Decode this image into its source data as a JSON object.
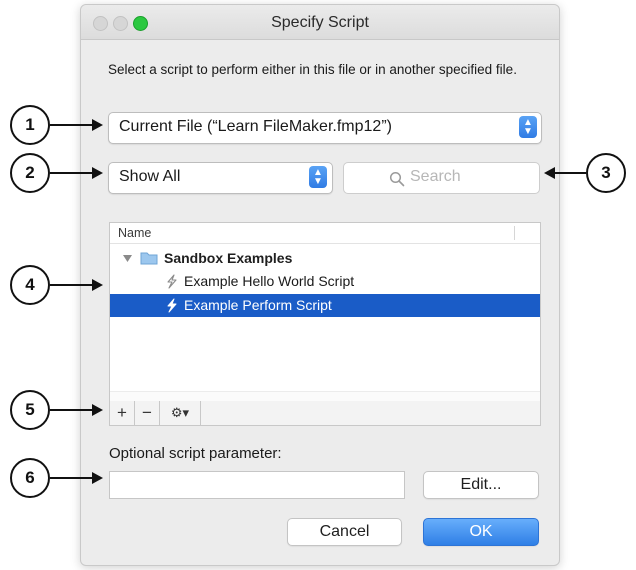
{
  "window": {
    "title": "Specify Script"
  },
  "instructions": "Select a script to perform either in this file or in another specified file.",
  "file_select": {
    "value": "Current File (“Learn FileMaker.fmp12”)"
  },
  "filter_select": {
    "value": "Show All"
  },
  "search": {
    "placeholder": "Search"
  },
  "script_list": {
    "column_header": "Name",
    "folder": {
      "label": "Sandbox Examples",
      "expanded": true
    },
    "items": [
      {
        "label": "Example Hello World Script",
        "selected": false
      },
      {
        "label": "Example Perform Script",
        "selected": true
      }
    ]
  },
  "toolbar": {
    "add_label": "+",
    "remove_label": "−",
    "gear_label": "⚙▾"
  },
  "parameter": {
    "label": "Optional script parameter:",
    "value": "",
    "edit_label": "Edit..."
  },
  "actions": {
    "cancel_label": "Cancel",
    "ok_label": "OK"
  },
  "callouts": [
    "1",
    "2",
    "3",
    "4",
    "5",
    "6"
  ],
  "colors": {
    "accent": "#2f7be4",
    "selection": "#1a5cc7",
    "maximize": "#2bc840"
  }
}
